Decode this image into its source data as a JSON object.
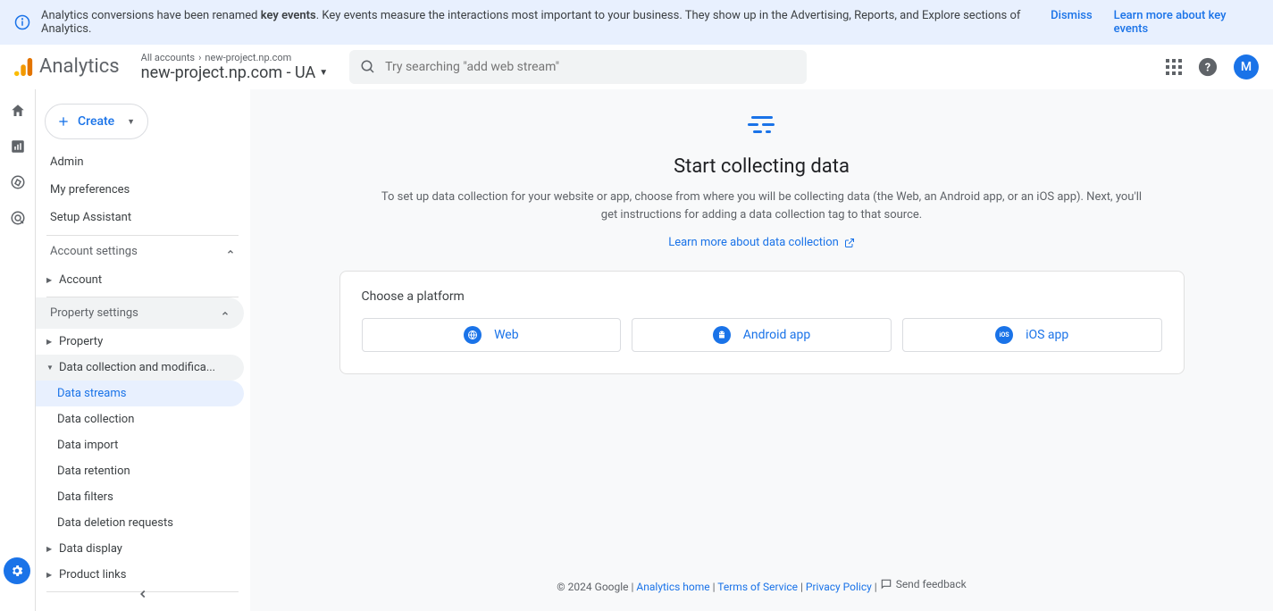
{
  "banner": {
    "text_before": "Analytics conversions have been renamed ",
    "text_bold": "key events",
    "text_after": ". Key events measure the interactions most important to your business. They show up in the Advertising, Reports, and Explore sections of Analytics.",
    "dismiss": "Dismiss",
    "learn_more": "Learn more about key events"
  },
  "topbar": {
    "product": "Analytics",
    "breadcrumb_root": "All accounts",
    "breadcrumb_leaf": "new-project.np.com",
    "property_title": "new-project.np.com - UA",
    "search_placeholder": "Try searching \"add web stream\"",
    "avatar_initial": "M"
  },
  "sidebar": {
    "create": "Create",
    "items": [
      "Admin",
      "My preferences",
      "Setup Assistant"
    ],
    "account_settings": "Account settings",
    "account": "Account",
    "property_settings": "Property settings",
    "property": "Property",
    "data_collection_mod": "Data collection and modifica...",
    "subitems": [
      "Data streams",
      "Data collection",
      "Data import",
      "Data retention",
      "Data filters",
      "Data deletion requests"
    ],
    "data_display": "Data display",
    "product_links": "Product links"
  },
  "main": {
    "title": "Start collecting data",
    "desc": "To set up data collection for your website or app, choose from where you will be collecting data (the Web, an Android app, or an iOS app). Next, you'll get instructions for adding a data collection tag to that source.",
    "link": "Learn more about data collection",
    "card_title": "Choose a platform",
    "platforms": [
      "Web",
      "Android app",
      "iOS app"
    ]
  },
  "footer": {
    "copyright": "© 2024 Google",
    "links": [
      "Analytics home",
      "Terms of Service",
      "Privacy Policy"
    ],
    "feedback": "Send feedback"
  }
}
